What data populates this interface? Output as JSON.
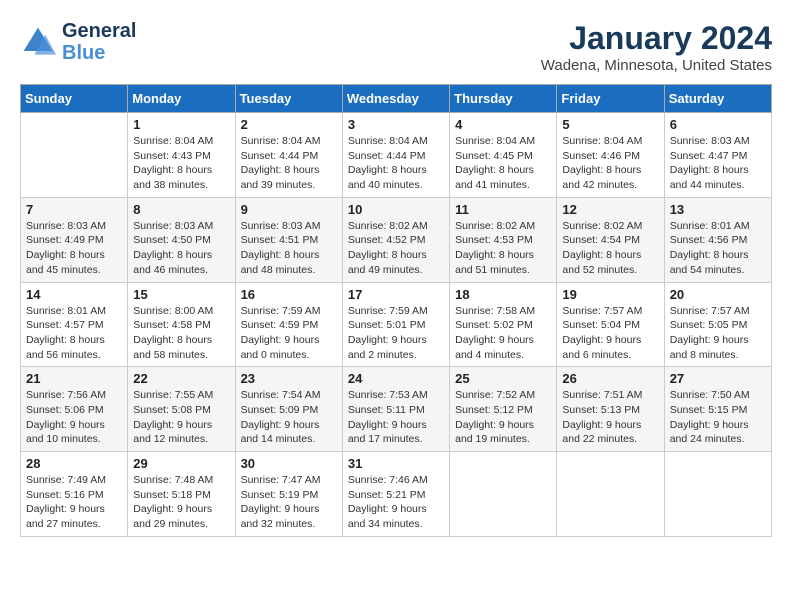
{
  "header": {
    "logo_line1": "General",
    "logo_line2": "Blue",
    "month_title": "January 2024",
    "location": "Wadena, Minnesota, United States"
  },
  "weekdays": [
    "Sunday",
    "Monday",
    "Tuesday",
    "Wednesday",
    "Thursday",
    "Friday",
    "Saturday"
  ],
  "weeks": [
    [
      {
        "day": "",
        "sunrise": "",
        "sunset": "",
        "daylight": ""
      },
      {
        "day": "1",
        "sunrise": "Sunrise: 8:04 AM",
        "sunset": "Sunset: 4:43 PM",
        "daylight": "Daylight: 8 hours and 38 minutes."
      },
      {
        "day": "2",
        "sunrise": "Sunrise: 8:04 AM",
        "sunset": "Sunset: 4:44 PM",
        "daylight": "Daylight: 8 hours and 39 minutes."
      },
      {
        "day": "3",
        "sunrise": "Sunrise: 8:04 AM",
        "sunset": "Sunset: 4:44 PM",
        "daylight": "Daylight: 8 hours and 40 minutes."
      },
      {
        "day": "4",
        "sunrise": "Sunrise: 8:04 AM",
        "sunset": "Sunset: 4:45 PM",
        "daylight": "Daylight: 8 hours and 41 minutes."
      },
      {
        "day": "5",
        "sunrise": "Sunrise: 8:04 AM",
        "sunset": "Sunset: 4:46 PM",
        "daylight": "Daylight: 8 hours and 42 minutes."
      },
      {
        "day": "6",
        "sunrise": "Sunrise: 8:03 AM",
        "sunset": "Sunset: 4:47 PM",
        "daylight": "Daylight: 8 hours and 44 minutes."
      }
    ],
    [
      {
        "day": "7",
        "sunrise": "Sunrise: 8:03 AM",
        "sunset": "Sunset: 4:49 PM",
        "daylight": "Daylight: 8 hours and 45 minutes."
      },
      {
        "day": "8",
        "sunrise": "Sunrise: 8:03 AM",
        "sunset": "Sunset: 4:50 PM",
        "daylight": "Daylight: 8 hours and 46 minutes."
      },
      {
        "day": "9",
        "sunrise": "Sunrise: 8:03 AM",
        "sunset": "Sunset: 4:51 PM",
        "daylight": "Daylight: 8 hours and 48 minutes."
      },
      {
        "day": "10",
        "sunrise": "Sunrise: 8:02 AM",
        "sunset": "Sunset: 4:52 PM",
        "daylight": "Daylight: 8 hours and 49 minutes."
      },
      {
        "day": "11",
        "sunrise": "Sunrise: 8:02 AM",
        "sunset": "Sunset: 4:53 PM",
        "daylight": "Daylight: 8 hours and 51 minutes."
      },
      {
        "day": "12",
        "sunrise": "Sunrise: 8:02 AM",
        "sunset": "Sunset: 4:54 PM",
        "daylight": "Daylight: 8 hours and 52 minutes."
      },
      {
        "day": "13",
        "sunrise": "Sunrise: 8:01 AM",
        "sunset": "Sunset: 4:56 PM",
        "daylight": "Daylight: 8 hours and 54 minutes."
      }
    ],
    [
      {
        "day": "14",
        "sunrise": "Sunrise: 8:01 AM",
        "sunset": "Sunset: 4:57 PM",
        "daylight": "Daylight: 8 hours and 56 minutes."
      },
      {
        "day": "15",
        "sunrise": "Sunrise: 8:00 AM",
        "sunset": "Sunset: 4:58 PM",
        "daylight": "Daylight: 8 hours and 58 minutes."
      },
      {
        "day": "16",
        "sunrise": "Sunrise: 7:59 AM",
        "sunset": "Sunset: 4:59 PM",
        "daylight": "Daylight: 9 hours and 0 minutes."
      },
      {
        "day": "17",
        "sunrise": "Sunrise: 7:59 AM",
        "sunset": "Sunset: 5:01 PM",
        "daylight": "Daylight: 9 hours and 2 minutes."
      },
      {
        "day": "18",
        "sunrise": "Sunrise: 7:58 AM",
        "sunset": "Sunset: 5:02 PM",
        "daylight": "Daylight: 9 hours and 4 minutes."
      },
      {
        "day": "19",
        "sunrise": "Sunrise: 7:57 AM",
        "sunset": "Sunset: 5:04 PM",
        "daylight": "Daylight: 9 hours and 6 minutes."
      },
      {
        "day": "20",
        "sunrise": "Sunrise: 7:57 AM",
        "sunset": "Sunset: 5:05 PM",
        "daylight": "Daylight: 9 hours and 8 minutes."
      }
    ],
    [
      {
        "day": "21",
        "sunrise": "Sunrise: 7:56 AM",
        "sunset": "Sunset: 5:06 PM",
        "daylight": "Daylight: 9 hours and 10 minutes."
      },
      {
        "day": "22",
        "sunrise": "Sunrise: 7:55 AM",
        "sunset": "Sunset: 5:08 PM",
        "daylight": "Daylight: 9 hours and 12 minutes."
      },
      {
        "day": "23",
        "sunrise": "Sunrise: 7:54 AM",
        "sunset": "Sunset: 5:09 PM",
        "daylight": "Daylight: 9 hours and 14 minutes."
      },
      {
        "day": "24",
        "sunrise": "Sunrise: 7:53 AM",
        "sunset": "Sunset: 5:11 PM",
        "daylight": "Daylight: 9 hours and 17 minutes."
      },
      {
        "day": "25",
        "sunrise": "Sunrise: 7:52 AM",
        "sunset": "Sunset: 5:12 PM",
        "daylight": "Daylight: 9 hours and 19 minutes."
      },
      {
        "day": "26",
        "sunrise": "Sunrise: 7:51 AM",
        "sunset": "Sunset: 5:13 PM",
        "daylight": "Daylight: 9 hours and 22 minutes."
      },
      {
        "day": "27",
        "sunrise": "Sunrise: 7:50 AM",
        "sunset": "Sunset: 5:15 PM",
        "daylight": "Daylight: 9 hours and 24 minutes."
      }
    ],
    [
      {
        "day": "28",
        "sunrise": "Sunrise: 7:49 AM",
        "sunset": "Sunset: 5:16 PM",
        "daylight": "Daylight: 9 hours and 27 minutes."
      },
      {
        "day": "29",
        "sunrise": "Sunrise: 7:48 AM",
        "sunset": "Sunset: 5:18 PM",
        "daylight": "Daylight: 9 hours and 29 minutes."
      },
      {
        "day": "30",
        "sunrise": "Sunrise: 7:47 AM",
        "sunset": "Sunset: 5:19 PM",
        "daylight": "Daylight: 9 hours and 32 minutes."
      },
      {
        "day": "31",
        "sunrise": "Sunrise: 7:46 AM",
        "sunset": "Sunset: 5:21 PM",
        "daylight": "Daylight: 9 hours and 34 minutes."
      },
      {
        "day": "",
        "sunrise": "",
        "sunset": "",
        "daylight": ""
      },
      {
        "day": "",
        "sunrise": "",
        "sunset": "",
        "daylight": ""
      },
      {
        "day": "",
        "sunrise": "",
        "sunset": "",
        "daylight": ""
      }
    ]
  ]
}
